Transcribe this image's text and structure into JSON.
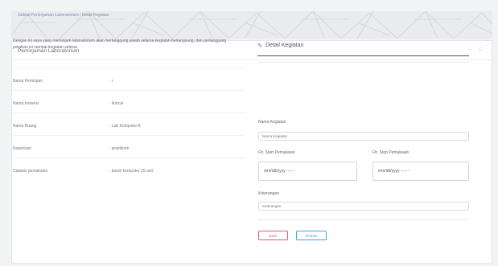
{
  "breadcrumb": {
    "parent": "Jadwal Peminjaman Laboratorium",
    "separator": "/",
    "current": "Detail Kegiatan"
  },
  "card": {
    "title": "Peminjaman Laboratorium",
    "tools": "– □"
  },
  "statement": "Dengan ini saya yang meminjam laboratorium akan bertanggung jawab selama kegiatan berlangsung, dan pertanggung jawaban ini sampai kegiatan selesai.",
  "info_rows": [
    {
      "label": "Nama Peminjam",
      "value": ": r"
    },
    {
      "label": "Nama Instansi",
      "value": ": Ikmcal"
    },
    {
      "label": "Nama Ruang",
      "value": ": Lab Komputer A"
    },
    {
      "label": "Keperluan",
      "value": ": praktikum"
    },
    {
      "label": "Catatan pemakaian",
      "value": ": butuh komputer 25 unit"
    }
  ],
  "form": {
    "section_icon": "pencil-icon",
    "section_title": "Detail Kegiatan",
    "nama_kegiatan_label": "Nama Kegiatan",
    "nama_kegiatan_placeholder": "Nama Kegiatan",
    "start_label": "Ftr. Start Pemakaian",
    "start_value": "mm/dd/yyyy --:-- -",
    "stop_label": "Ftr. Stop Pemakaian",
    "stop_value": "mm/dd/yyyy --:-- -",
    "keterangan_label": "Keterangan",
    "keterangan_placeholder": "Keterangan",
    "back_label": "Back",
    "save_label": "Simpan"
  },
  "colors": {
    "back": "#e4586a",
    "save": "#43a5e8",
    "breadcrumb_link": "#7b8fb6"
  }
}
